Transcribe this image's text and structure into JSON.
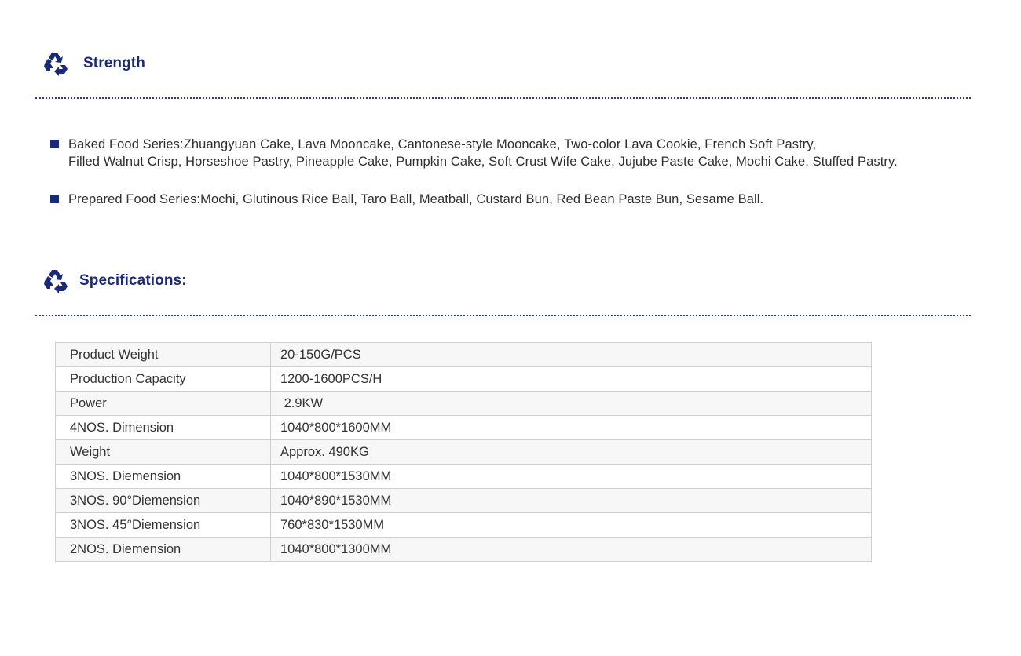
{
  "sections": {
    "strength": {
      "title": "Strength",
      "icon": "recycle-icon"
    },
    "specifications": {
      "title": "Specifications:",
      "icon": "recycle-icon"
    }
  },
  "strength_items": [
    {
      "lines": [
        "Baked Food Series:Zhuangyuan Cake, Lava Mooncake, Cantonese-style Mooncake, Two-color Lava Cookie, French Soft Pastry,",
        "Filled Walnut Crisp, Horseshoe Pastry, Pineapple Cake, Pumpkin Cake, Soft Crust Wife Cake, Jujube Paste Cake, Mochi Cake, Stuffed Pastry."
      ]
    },
    {
      "lines": [
        "Prepared Food Series:Mochi, Glutinous Rice Ball, Taro Ball, Meatball, Custard Bun, Red Bean Paste Bun, Sesame Ball."
      ]
    }
  ],
  "spec_table": [
    {
      "label": "Product Weight",
      "value": "20-150G/PCS"
    },
    {
      "label": "Production Capacity",
      "value": "1200-1600PCS/H"
    },
    {
      "label": "Power",
      "value": " 2.9KW"
    },
    {
      "label": "4NOS. Dimension",
      "value": "1040*800*1600MM"
    },
    {
      "label": "Weight",
      "value": "Approx. 490KG"
    },
    {
      "label": "3NOS. Diemension",
      "value": "1040*800*1530MM"
    },
    {
      "label": "3NOS. 90°Diemension",
      "value": "1040*890*1530MM"
    },
    {
      "label": "3NOS. 45°Diemension",
      "value": "760*830*1530MM"
    },
    {
      "label": "2NOS. Diemension",
      "value": "1040*800*1300MM"
    }
  ],
  "colors": {
    "accent": "#1b2a78",
    "text": "#2f2f2f",
    "table_border": "#cfcfcf"
  }
}
